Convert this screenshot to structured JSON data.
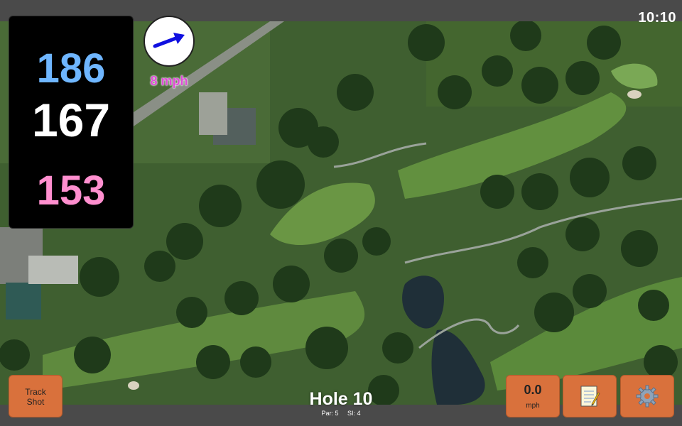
{
  "status": {
    "time": "10:10"
  },
  "distances": {
    "back": "186",
    "middle": "167",
    "front": "153"
  },
  "wind": {
    "speed": "8 mph",
    "direction_icon": "arrow-icon"
  },
  "buttons": {
    "track_shot": {
      "line1": "Track",
      "line2": "Shot"
    },
    "speed": {
      "value": "0.0",
      "unit": "mph"
    },
    "notes": {
      "icon": "notepad-icon"
    },
    "settings": {
      "icon": "gear-icon"
    }
  },
  "hole": {
    "title": "Hole 10",
    "par": "Par: 5",
    "si": "SI: 4"
  },
  "colors": {
    "back_distance": "#6fb6ff",
    "middle_distance": "#ffffff",
    "front_distance": "#ff8fcf",
    "wind_text": "#e04bd8",
    "button_bg": "#d9713c",
    "bar_bg": "#4a4a4a"
  }
}
